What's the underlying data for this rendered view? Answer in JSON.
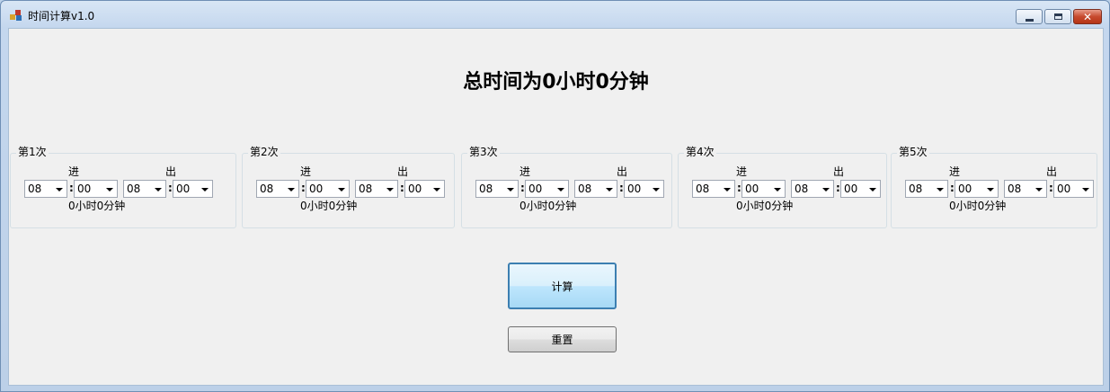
{
  "window": {
    "title": "时间计算v1.0",
    "controls": {
      "minimize": "minimize-icon",
      "maximize": "maximize-icon",
      "close": "close-icon"
    }
  },
  "total_label": "总时间为0小时0分钟",
  "labels": {
    "in": "进",
    "out": "出",
    "separator": ":"
  },
  "groups": [
    {
      "title": "第1次",
      "in_hour": "08",
      "in_minute": "00",
      "out_hour": "08",
      "out_minute": "00",
      "duration": "0小时0分钟"
    },
    {
      "title": "第2次",
      "in_hour": "08",
      "in_minute": "00",
      "out_hour": "08",
      "out_minute": "00",
      "duration": "0小时0分钟"
    },
    {
      "title": "第3次",
      "in_hour": "08",
      "in_minute": "00",
      "out_hour": "08",
      "out_minute": "00",
      "duration": "0小时0分钟"
    },
    {
      "title": "第4次",
      "in_hour": "08",
      "in_minute": "00",
      "out_hour": "08",
      "out_minute": "00",
      "duration": "0小时0分钟"
    },
    {
      "title": "第5次",
      "in_hour": "08",
      "in_minute": "00",
      "out_hour": "08",
      "out_minute": "00",
      "duration": "0小时0分钟"
    }
  ],
  "buttons": {
    "calculate": "计算",
    "reset": "重置"
  },
  "colors": {
    "focus_border": "#3c7fb1",
    "client_bg": "#f0f0f0",
    "close_button": "#c74a2f"
  }
}
